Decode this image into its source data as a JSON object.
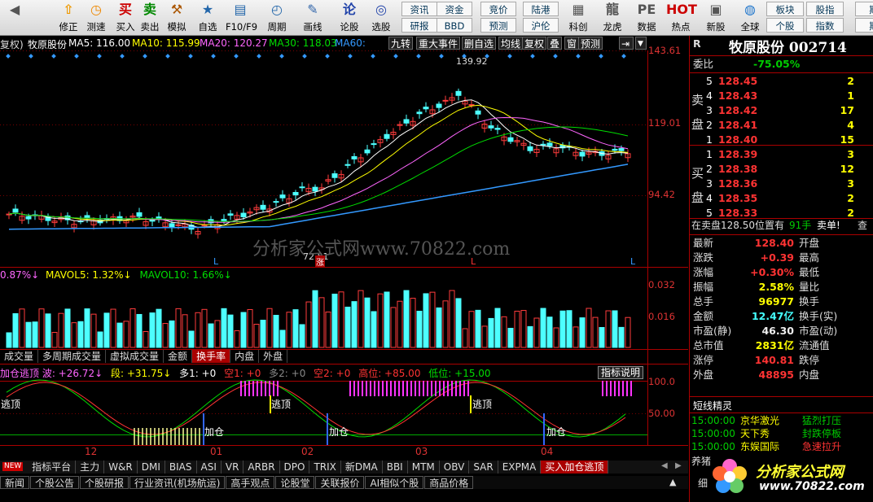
{
  "toolbar": {
    "items": [
      {
        "label": "",
        "icon": "back"
      },
      {
        "label": "修正",
        "icon": "arrow-up"
      },
      {
        "label": "测速",
        "icon": "clock"
      },
      {
        "label": "买入",
        "icon": "buy"
      },
      {
        "label": "卖出",
        "icon": "sell"
      },
      {
        "label": "模拟",
        "icon": "hammer"
      },
      {
        "label": "自选",
        "icon": "star"
      },
      {
        "label": "F10/F9",
        "icon": "f10"
      },
      {
        "label": "周期",
        "icon": "period"
      },
      {
        "label": "画线",
        "icon": "pen"
      },
      {
        "label": "论股",
        "icon": "discuss"
      },
      {
        "label": "选股",
        "icon": "search"
      },
      {
        "label": "科创",
        "icon": "kechuang"
      },
      {
        "label": "龙虎",
        "icon": "dragon"
      },
      {
        "label": "数据",
        "icon": "pe"
      },
      {
        "label": "热点",
        "icon": "hot"
      },
      {
        "label": "新股",
        "icon": "newstock"
      },
      {
        "label": "全球",
        "icon": "globe"
      }
    ],
    "top_boxes": [
      "资讯",
      "资金",
      "竞价",
      "陆港",
      "板块",
      "股指",
      "期"
    ],
    "bottom_boxes": [
      "研报",
      "BBD",
      "预测",
      "沪伦",
      "个股",
      "指数",
      "期"
    ]
  },
  "header": {
    "prefix": "复权)",
    "stock": "牧原股份",
    "ma5": "MA5: 116.00",
    "ma10": "MA10: 115.99",
    "ma20": "MA20: 120.27",
    "ma30": "MA30: 118.03",
    "ma60": "MA60:",
    "buttons": [
      "九转",
      "重大事件",
      "删自选",
      "均线",
      "复权",
      "叠",
      "窗",
      "预测"
    ]
  },
  "price_axis": [
    "143.61",
    "119.01",
    "94.42"
  ],
  "annotations": {
    "high": "139.92",
    "low": "72.51",
    "zhang": "涨"
  },
  "watermark": "分析家公式网www.70822.com",
  "vol_header": {
    "a": "0.87%↓",
    "b": "MAVOL5: 1.32%↓",
    "c": "MAVOL10: 1.66%↓"
  },
  "vol_axis": [
    "0.032",
    "0.016"
  ],
  "tabs1": [
    "成交量",
    "多周期成交量",
    "虚拟成交量",
    "金额",
    "换手率",
    "内盘",
    "外盘"
  ],
  "ind_header": {
    "a": "加仓逃顶 波: +26.72↓",
    "b": "段: +31.75↓",
    "c": "多1: +0",
    "d": "空1: +0",
    "e": "多2: +0",
    "f": "空2: +0",
    "g": "高位: +85.00",
    "h": "低位: +15.00",
    "btn": "指标说明"
  },
  "ind_axis": [
    "100.0",
    "50.00"
  ],
  "ind_labels": {
    "tao": "逃顶",
    "jia": "加仓"
  },
  "months": [
    "12",
    "01",
    "02",
    "03",
    "04"
  ],
  "tabs2": [
    "指标平台",
    "主力",
    "W&R",
    "DMI",
    "BIAS",
    "ASI",
    "VR",
    "ARBR",
    "DPO",
    "TRIX",
    "新DMA",
    "BBI",
    "MTM",
    "OBV",
    "SAR",
    "EXPMA",
    "买入加仓逃顶"
  ],
  "new_badge": "NEW",
  "tabs3": [
    "新闻",
    "个股公告",
    "个股研报",
    "行业资讯(机场航运)",
    "高手观点",
    "论股堂",
    "关联报价",
    "AI相似个股",
    "商品价格"
  ],
  "right": {
    "code": "R",
    "title": "牧原股份 002714",
    "weibi": {
      "label": "委比",
      "value": "-75.05%"
    },
    "sell_label": "卖盘",
    "buy_label": "买盘",
    "sell": [
      {
        "n": "5",
        "p": "128.45",
        "v": "2"
      },
      {
        "n": "4",
        "p": "128.43",
        "v": "1"
      },
      {
        "n": "3",
        "p": "128.42",
        "v": "17"
      },
      {
        "n": "2",
        "p": "128.41",
        "v": "4"
      },
      {
        "n": "1",
        "p": "128.40",
        "v": "15"
      }
    ],
    "buy": [
      {
        "n": "1",
        "p": "128.39",
        "v": "3"
      },
      {
        "n": "2",
        "p": "128.38",
        "v": "12"
      },
      {
        "n": "3",
        "p": "128.36",
        "v": "3"
      },
      {
        "n": "4",
        "p": "128.35",
        "v": "2"
      },
      {
        "n": "5",
        "p": "128.33",
        "v": "2"
      }
    ],
    "zaimai": {
      "a": "在卖盘128.50位置有",
      "b": "91手",
      "c": "卖单!",
      "d": "查"
    },
    "stats": [
      {
        "l": "最新",
        "v": "128.40",
        "l2": "开盘",
        "c": "red"
      },
      {
        "l": "涨跌",
        "v": "+0.39",
        "l2": "最高",
        "c": "red"
      },
      {
        "l": "涨幅",
        "v": "+0.30%",
        "l2": "最低",
        "c": "red"
      },
      {
        "l": "振幅",
        "v": "2.58%",
        "l2": "量比",
        "c": "yel"
      },
      {
        "l": "总手",
        "v": "96977",
        "l2": "换手",
        "c": "yel"
      },
      {
        "l": "金额",
        "v": "12.47亿",
        "l2": "换手(实)",
        "c": "cyn"
      },
      {
        "l": "市盈(静)",
        "v": "46.30",
        "l2": "市盈(动)",
        "c": "wht"
      },
      {
        "l": "总市值",
        "v": "2831亿",
        "l2": "流通值",
        "c": "yel"
      },
      {
        "l": "涨停",
        "v": "140.81",
        "l2": "跌停",
        "c": "red"
      },
      {
        "l": "外盘",
        "v": "48895",
        "l2": "内盘",
        "c": "red"
      }
    ],
    "jingling": "短线精灵",
    "alerts": [
      {
        "t": "15:00:00",
        "name": "京华激光",
        "ev": "猛烈打压"
      },
      {
        "t": "15:00:00",
        "name": "天下秀",
        "ev": "封跌停板"
      },
      {
        "t": "15:00:00",
        "name": "东娱国际",
        "ev": "急速拉升"
      }
    ],
    "bottom": [
      "养猪",
      "细"
    ]
  },
  "logo": {
    "cn": "分析家公式网",
    "url": "www.70822.com"
  },
  "colors": {
    "up": "#ff3c3c",
    "down": "#4dffff",
    "ma5": "#ffffff",
    "ma10": "#ffff00",
    "ma20": "#ff66ff",
    "ma30": "#00dd00",
    "ma60": "#3399ff"
  }
}
